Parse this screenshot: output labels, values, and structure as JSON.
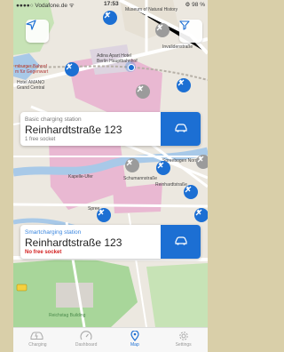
{
  "status_bar": {
    "carrier": "●●●●○ Vodafone.de ᯤ",
    "time": "17:53",
    "battery": "⚙ 98 %"
  },
  "map": {
    "labels": {
      "museum": "Museum of Natural History",
      "invalidenstr": "Invalidenstraße",
      "hamburger_bahnhof": "mburger Bahnof",
      "museum_gegenwart": "m für Gegenwart",
      "hotel_amano": "Hotel AMANO",
      "grand_central": "Grand Central",
      "adina": "Adina Apart Hotel Berlin Hauptbahnhof",
      "spree": "Spree",
      "spreebogen": "Spreebogen Nord",
      "reinhardtstr": "Reinhardtstraße",
      "schumannstr": "Schumannstraße",
      "kapelle_ufer": "Kapelle-Ufer",
      "reichstag": "Reichstag Building",
      "reichstagsufer": "Reichstagufer"
    },
    "locate_icon": "location-arrow-icon",
    "filter_icon": "filter-icon"
  },
  "cards": [
    {
      "kind": "Basic charging station",
      "address": "Reinhardtstraße 123",
      "status": "1 free socket"
    },
    {
      "kind": "Smartcharging station",
      "address": "Reinhardtstraße 123",
      "status": "No free socket"
    }
  ],
  "tabs": [
    {
      "label": "Charging",
      "icon": "car-charging-icon",
      "active": false
    },
    {
      "label": "Dashboard",
      "icon": "speedometer-icon",
      "active": false
    },
    {
      "label": "Map",
      "icon": "map-pin-icon",
      "active": true
    },
    {
      "label": "Settings",
      "icon": "gear-icon",
      "active": false
    }
  ],
  "colors": {
    "accent": "#1c6fd3",
    "error": "#d21f1f",
    "pink_area": "#e9b8d2",
    "park": "#a8d69a",
    "water": "#a8c9e8"
  }
}
